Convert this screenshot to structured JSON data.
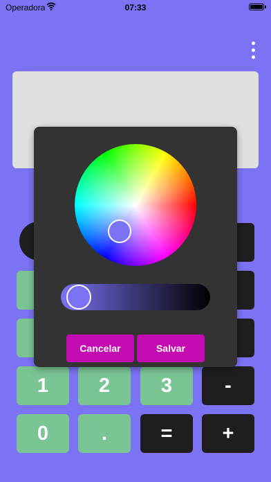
{
  "status_bar": {
    "carrier": "Operadora",
    "time": "07:33"
  },
  "keypad": {
    "rows": [
      [
        "1",
        "2",
        "3",
        "-"
      ],
      [
        "0",
        ".",
        "=",
        "+"
      ]
    ]
  },
  "color_picker": {
    "selected_color": "#7b73f3",
    "brightness": 0.0,
    "cancel_label": "Cancelar",
    "save_label": "Salvar"
  },
  "colors": {
    "background": "#7b73f3",
    "number_key": "#7bc494",
    "operator_key": "#1e1e1e",
    "dialog": "#333333",
    "dialog_button": "#c40bb1",
    "display": "#e0e0e0"
  }
}
